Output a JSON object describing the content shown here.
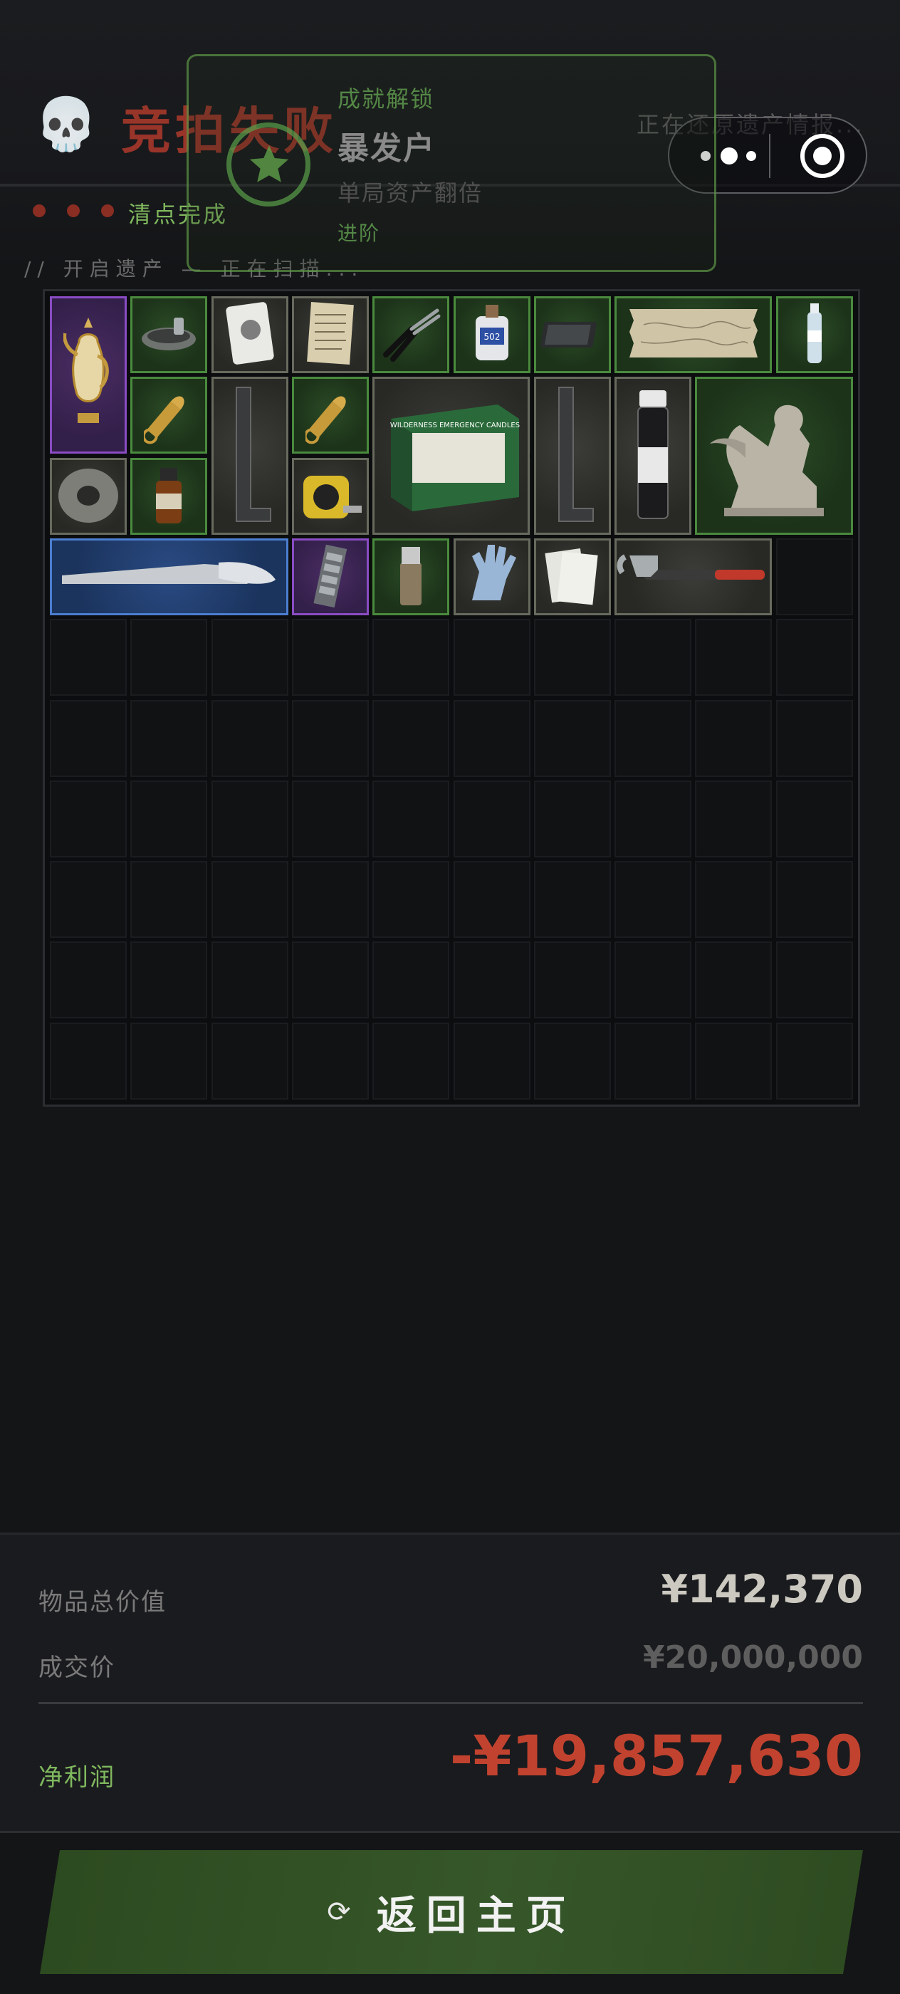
{
  "header": {
    "skull_icon": "💀",
    "title": "竞拍失败",
    "status_right": "正在还原遗产情报...",
    "progress_dots": 3,
    "check_complete": "清点完成",
    "scan_text": "// 开启遗产 — 正在扫描..."
  },
  "capsule": {
    "more_icon": "more-dots-icon",
    "close_icon": "target-circle-icon"
  },
  "toast": {
    "unlock_label": "成就解锁",
    "name": "暴发户",
    "description": "单局资产翻倍",
    "tag": "进阶"
  },
  "inventory": {
    "grid_columns": 10,
    "grid_rows": 10,
    "items": [
      {
        "name": "golden-ewer",
        "rarity": "purple"
      },
      {
        "name": "ashtray-bowl",
        "rarity": "green"
      },
      {
        "name": "playing-card",
        "rarity": "gray"
      },
      {
        "name": "old-letter",
        "rarity": "gray"
      },
      {
        "name": "pliers",
        "rarity": "green"
      },
      {
        "name": "saline-bottle",
        "rarity": "green"
      },
      {
        "name": "hard-drive",
        "rarity": "green"
      },
      {
        "name": "old-map",
        "rarity": "green"
      },
      {
        "name": "water-bottle",
        "rarity": "green"
      },
      {
        "name": "bullet",
        "rarity": "green"
      },
      {
        "name": "metal-rail",
        "rarity": "gray"
      },
      {
        "name": "bullet",
        "rarity": "green"
      },
      {
        "name": "emergency-candles",
        "rarity": "gray"
      },
      {
        "name": "metal-rail",
        "rarity": "gray"
      },
      {
        "name": "sample-vial",
        "rarity": "gray"
      },
      {
        "name": "sphinx-statue",
        "rarity": "green"
      },
      {
        "name": "duct-tape",
        "rarity": "gray"
      },
      {
        "name": "medicine-bottle",
        "rarity": "green"
      },
      {
        "name": "tape-measure",
        "rarity": "gray"
      },
      {
        "name": "saw-blade",
        "rarity": "blue"
      },
      {
        "name": "ram-stick",
        "rarity": "purple"
      },
      {
        "name": "lighter",
        "rarity": "green"
      },
      {
        "name": "gloves",
        "rarity": "gray"
      },
      {
        "name": "receipts",
        "rarity": "gray"
      },
      {
        "name": "hammer",
        "rarity": "gray"
      }
    ]
  },
  "summary": {
    "total_value_label": "物品总价值",
    "total_value": "¥142,370",
    "deal_price_label": "成交价",
    "deal_price": "¥20,000,000",
    "profit_label": "净利润",
    "profit": "-¥19,857,630"
  },
  "actions": {
    "refresh_icon": "⟳",
    "home_label": "返回主页"
  },
  "colors": {
    "fail_red": "#b53b2c",
    "success_green": "#7fb85e",
    "profit_red": "#c1432f",
    "button_green": "#36572a"
  }
}
